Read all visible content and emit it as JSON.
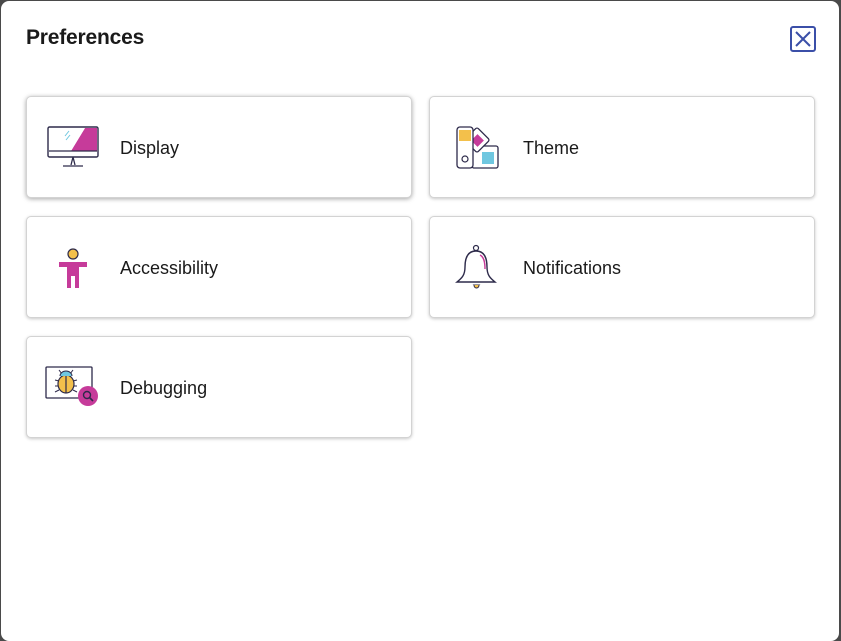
{
  "dialog": {
    "title": "Preferences",
    "close_icon": "close-icon"
  },
  "cards": [
    {
      "id": "display",
      "label": "Display",
      "icon": "monitor-icon"
    },
    {
      "id": "theme",
      "label": "Theme",
      "icon": "color-swatch-icon"
    },
    {
      "id": "accessibility",
      "label": "Accessibility",
      "icon": "accessibility-person-icon"
    },
    {
      "id": "notifications",
      "label": "Notifications",
      "icon": "bell-icon"
    },
    {
      "id": "debugging",
      "label": "Debugging",
      "icon": "bug-search-icon"
    }
  ],
  "colors": {
    "accent_magenta": "#c63b9a",
    "accent_yellow": "#f3c04b",
    "accent_cyan": "#6fc7e0",
    "outline": "#2d2a4a",
    "close_border": "#3b4fa8"
  }
}
